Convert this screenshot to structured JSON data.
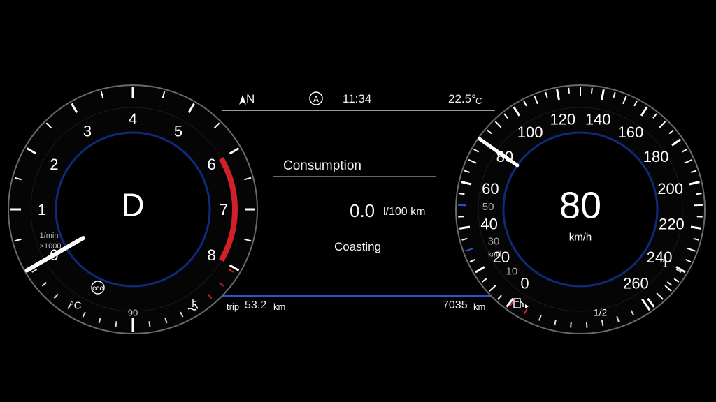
{
  "status_bar": {
    "direction": "N",
    "auto_hold": "A",
    "time": "11:34",
    "outside_temp": "22.5°",
    "temp_unit": "C"
  },
  "center": {
    "title": "Consumption",
    "consumption_value": "0.0",
    "consumption_unit": "l/100 km",
    "mode_text": "Coasting"
  },
  "bottom": {
    "trip_label": "trip",
    "trip_value": "53.2",
    "trip_unit": "km",
    "odometer_value": "7035",
    "odometer_unit": "km"
  },
  "tachometer": {
    "gear": "D",
    "unit_line1": "1/min",
    "unit_line2": "×1000",
    "labels": [
      "0",
      "1",
      "2",
      "3",
      "4",
      "5",
      "6",
      "7",
      "8"
    ],
    "max": 8,
    "redline_from": 6,
    "value": 0,
    "eco_label": "eco",
    "coolant_unit": "°C",
    "coolant_mid_label": "90",
    "coolant_level": 0.5
  },
  "speedometer": {
    "speed": "80",
    "unit": "km/h",
    "small_unit": "km/h",
    "major_labels": [
      "0",
      "20",
      "40",
      "60",
      "80",
      "100",
      "120",
      "140",
      "160",
      "180",
      "200",
      "220",
      "240",
      "260"
    ],
    "minor_labels": [
      "10",
      "30",
      "50"
    ],
    "max": 260,
    "value": 80,
    "fuel_labels": [
      "1/2",
      "1"
    ],
    "fuel_level": 0.75
  },
  "colors": {
    "accent_blue": "#2a56c8",
    "redline": "#d0202a",
    "needle": "#ffffff"
  }
}
